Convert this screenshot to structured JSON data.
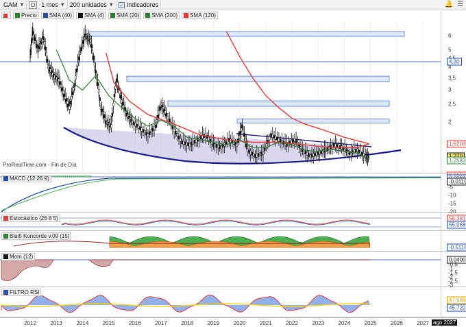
{
  "toolbar": {
    "symbol": "GAM",
    "d_label": "D",
    "period": "1 mes",
    "units": "200 unidades",
    "indicators": "Indicadores"
  },
  "price_panel": {
    "legend": [
      {
        "label": "Precio",
        "color": "#2e7d32"
      },
      {
        "label": "SMA (40)",
        "color": "#1f4fa8"
      },
      {
        "label": "SMA (4)",
        "color": "#111111"
      },
      {
        "label": "SMA (20)",
        "color": "#2e7d32"
      },
      {
        "label": "SMA (200)",
        "color": "#2e7d32"
      },
      {
        "label": "SMA (120)",
        "color": "#e53935"
      }
    ],
    "y_ticks": [
      "6",
      "5",
      "4,5",
      "4",
      "3,5",
      "3",
      "2,5",
      "2",
      "1,5"
    ],
    "tags": [
      {
        "text": "4,30",
        "color": "#1f4fa8",
        "bg": "#ffffff"
      },
      {
        "text": "1,5203",
        "color": "#e53935",
        "bg": "#ffffff"
      },
      {
        "text": "1,270",
        "color": "#111111",
        "bg": "#f7e36b"
      },
      {
        "text": "1,2583",
        "color": "#2e7d32",
        "bg": "#ffffff"
      }
    ],
    "watermark": "ProRealTime.com - Fin de Día"
  },
  "macd_panel": {
    "legend": "MACD (12 26 9)",
    "y_ticks": [
      "-5",
      "-10",
      "-15",
      "-20"
    ],
    "tags": [
      {
        "text": "0,0053",
        "color": "#e53935"
      },
      {
        "text": "0,0068",
        "color": "#1f4fa8"
      },
      {
        "text": "-0,0119",
        "color": "#111111"
      }
    ]
  },
  "stoch_panel": {
    "legend": "Estocástico (26 8 5)",
    "tags": [
      {
        "text": "56,381",
        "color": "#e53935"
      },
      {
        "text": "55,068",
        "color": "#1f4fa8"
      }
    ]
  },
  "blai_panel": {
    "legend": "Blai5 Koncorde v.09 (15)",
    "tags": [
      {
        "text": "-0,5116",
        "color": "#1f4fa8"
      }
    ]
  },
  "mom_panel": {
    "legend": "Mom (12)",
    "y_ticks": [
      "-0,5",
      "-1",
      "-1,5",
      "-2",
      "-2,5",
      "-3"
    ],
    "tags": [
      {
        "text": "0,0400",
        "color": "#111111"
      }
    ]
  },
  "rsi_panel": {
    "legend": "FILTRO RSI",
    "tags": [
      {
        "text": "47,988",
        "color": "#e6a700"
      },
      {
        "text": "45,720",
        "color": "#1f4fa8"
      }
    ]
  },
  "x_axis": {
    "labels": [
      "2012",
      "2013",
      "2014",
      "2015",
      "2016",
      "2017",
      "2018",
      "2019",
      "2020",
      "2021",
      "2022",
      "2023",
      "2024",
      "2025",
      "2026",
      "2027"
    ],
    "end_label": "ago 2027"
  }
}
